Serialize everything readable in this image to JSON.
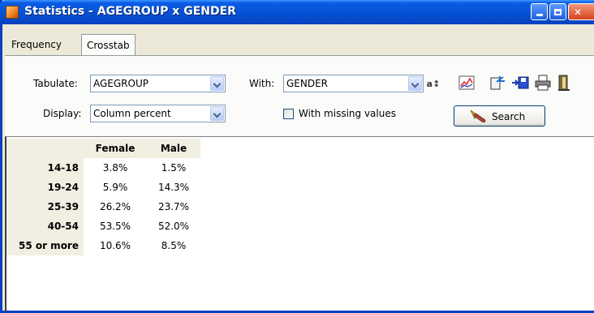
{
  "window": {
    "title": "Statistics - AGEGROUP x GENDER"
  },
  "tabs": [
    {
      "label": "Frequency",
      "active": false
    },
    {
      "label": "Crosstab",
      "active": true
    }
  ],
  "controls": {
    "tabulate_label": "Tabulate:",
    "tabulate_value": "AGEGROUP",
    "with_label": "With:",
    "with_value": "GENDER",
    "display_label": "Display:",
    "display_value": "Column percent",
    "missing_label": "With missing values",
    "missing_checked": false,
    "search_label": "Search"
  },
  "toolbar_icons": [
    "sort-abc-icon",
    "graph-icon",
    "export-icon",
    "save-icon",
    "print-icon",
    "exit-icon"
  ],
  "table": {
    "columns": [
      "Female",
      "Male"
    ],
    "rows": [
      {
        "label": "14-18",
        "values": [
          "3.8%",
          "1.5%"
        ]
      },
      {
        "label": "19-24",
        "values": [
          "5.9%",
          "14.3%"
        ]
      },
      {
        "label": "25-39",
        "values": [
          "26.2%",
          "23.7%"
        ]
      },
      {
        "label": "40-54",
        "values": [
          "53.5%",
          "52.0%"
        ]
      },
      {
        "label": "55 or more",
        "values": [
          "10.6%",
          "8.5%"
        ]
      }
    ]
  }
}
